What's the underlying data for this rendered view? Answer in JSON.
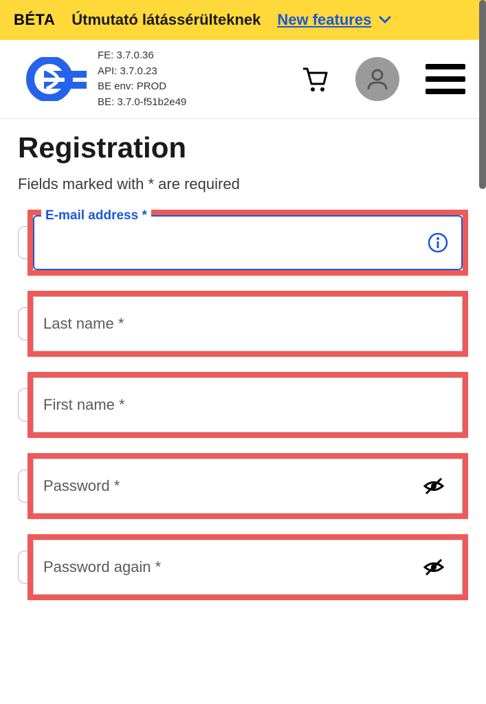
{
  "banner": {
    "badge": "BÉTA",
    "guide": "Útmutató látássérülteknek",
    "link": "New features"
  },
  "version": {
    "fe": "FE: 3.7.0.36",
    "api": "API: 3.7.0.23",
    "be_env": "BE env: PROD",
    "be": "BE: 3.7.0-f51b2e49"
  },
  "page": {
    "title": "Registration",
    "subtitle": "Fields marked with * are required"
  },
  "fields": {
    "email": "E-mail address *",
    "lastname": "Last name *",
    "firstname": "First name *",
    "password": "Password *",
    "password_again": "Password again *"
  }
}
